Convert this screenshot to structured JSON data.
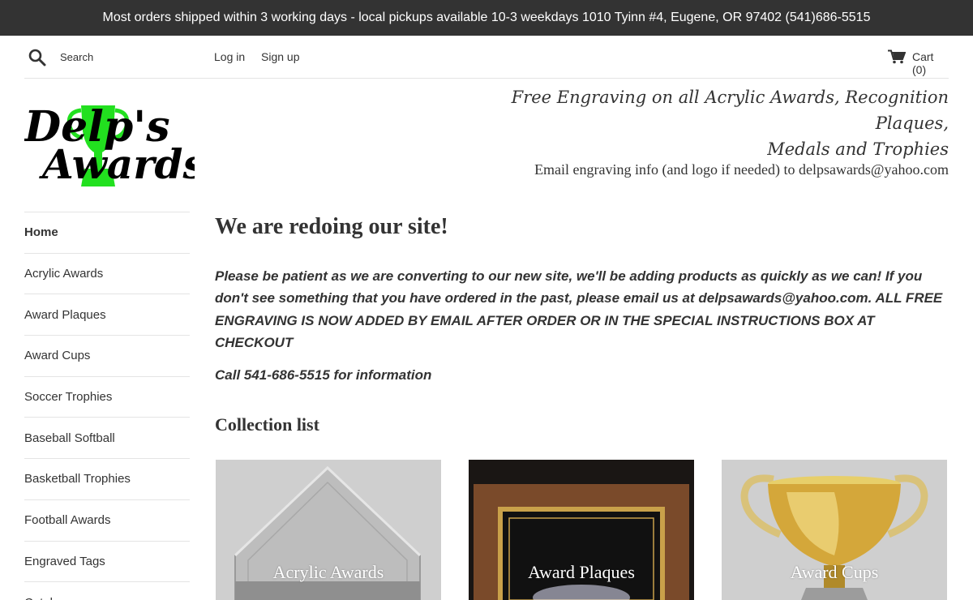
{
  "announcement": "Most orders shipped within 3 working days - local pickups available 10-3 weekdays 1010 Tyinn #4, Eugene, OR 97402 (541)686-5515",
  "topbar": {
    "search_placeholder": "Search",
    "login": "Log in",
    "signup": "Sign up",
    "cart": "Cart (0)"
  },
  "logo": {
    "line1": "Delp's",
    "line2": "Awards",
    "brand_color": "#22e01f"
  },
  "header": {
    "tagline_line1": "Free Engraving on all Acrylic Awards, Recognition Plaques,",
    "tagline_line2": "Medals and Trophies",
    "email_line": "Email engraving info (and logo if needed) to delpsawards@yahoo.com"
  },
  "sidebar": {
    "items": [
      {
        "label": "Home",
        "active": true
      },
      {
        "label": "Acrylic Awards"
      },
      {
        "label": "Award Plaques"
      },
      {
        "label": "Award Cups"
      },
      {
        "label": "Soccer Trophies"
      },
      {
        "label": "Baseball Softball"
      },
      {
        "label": "Basketball Trophies"
      },
      {
        "label": "Football Awards"
      },
      {
        "label": "Engraved Tags"
      },
      {
        "label": "Catalogs"
      }
    ]
  },
  "main": {
    "heading": "We are redoing our site!",
    "notice": "Please be patient as we are converting to our new site, we'll be adding products as quickly as we can! If you don't see something that you have ordered in the past, please email us at delpsawards@yahoo.com. ALL FREE ENGRAVING IS NOW ADDED BY EMAIL AFTER ORDER OR IN THE SPECIAL INSTRUCTIONS BOX AT CHECKOUT",
    "call": "Call 541-686-5515 for information",
    "collection_heading": "Collection list",
    "collections": [
      {
        "label": "Acrylic Awards"
      },
      {
        "label": "Award Plaques"
      },
      {
        "label": "Award Cups"
      }
    ]
  }
}
